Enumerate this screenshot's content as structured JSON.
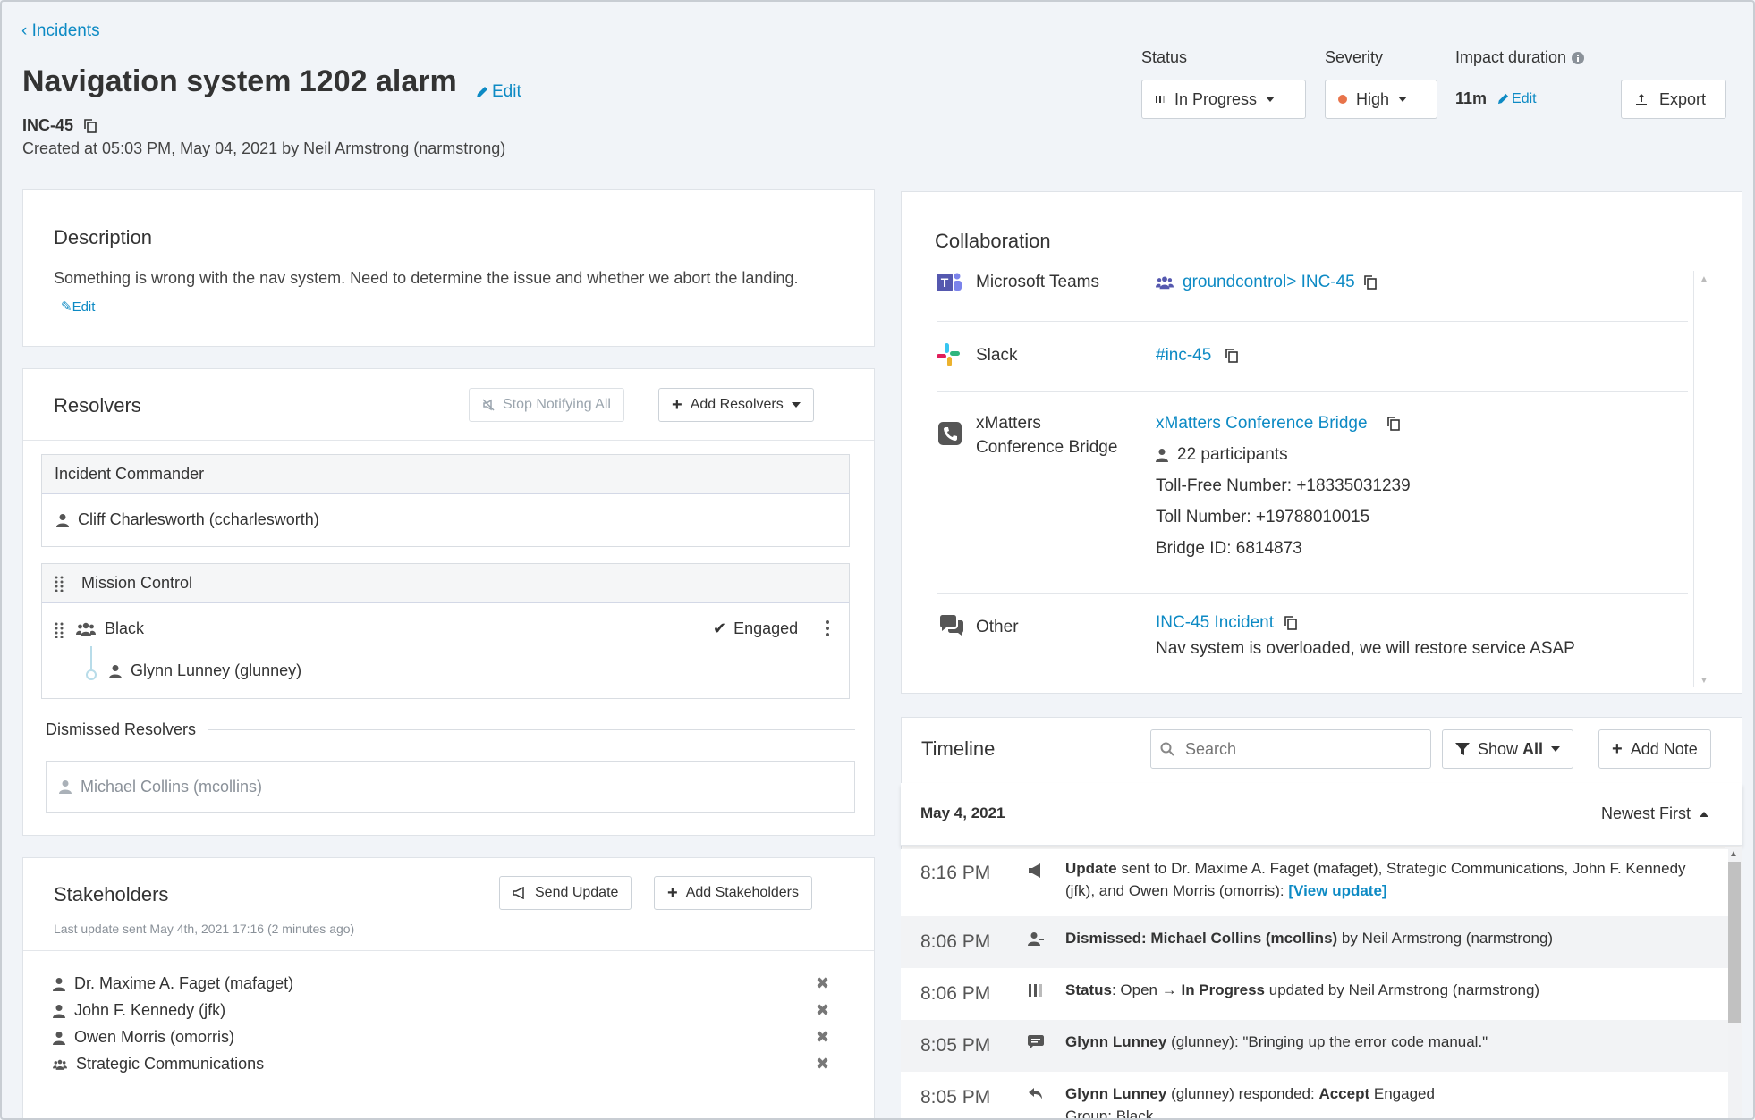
{
  "back": {
    "label": "Incidents"
  },
  "incident": {
    "title": "Navigation system 1202 alarm",
    "edit_label": "Edit",
    "id": "INC-45",
    "created": "Created at 05:03 PM, May 04, 2021 by Neil Armstrong (narmstrong)"
  },
  "header": {
    "status_label": "Status",
    "status_value": "In Progress",
    "severity_label": "Severity",
    "severity_value": "High",
    "severity_color": "#e8734a",
    "impact_label": "Impact duration",
    "impact_value": "11m",
    "impact_edit": "Edit",
    "export_label": "Export"
  },
  "description": {
    "title": "Description",
    "text": "Something is wrong with the nav system. Need to determine the issue and whether we abort the landing.",
    "edit_label": "Edit"
  },
  "resolvers": {
    "title": "Resolvers",
    "stop_label": "Stop Notifying All",
    "add_label": "Add Resolvers",
    "commander_title": "Incident Commander",
    "commander_name": "Cliff Charlesworth (ccharlesworth)",
    "mission_title": "Mission Control",
    "team_name": "Black",
    "team_status": "Engaged",
    "member_name": "Glynn Lunney (glunney)",
    "dismissed_title": "Dismissed Resolvers",
    "dismissed_name": "Michael Collins (mcollins)"
  },
  "stakeholders": {
    "title": "Stakeholders",
    "send_label": "Send Update",
    "add_label": "Add Stakeholders",
    "last_update": "Last update sent May 4th, 2021 17:16 (2 minutes ago)",
    "items": [
      {
        "name": "Dr. Maxime A. Faget (mafaget)",
        "icon": "user-icon"
      },
      {
        "name": "John F. Kennedy (jfk)",
        "icon": "user-icon"
      },
      {
        "name": "Owen Morris (omorris)",
        "icon": "user-icon"
      },
      {
        "name": "Strategic Communications",
        "icon": "group-icon"
      }
    ]
  },
  "collaboration": {
    "title": "Collaboration",
    "teams": {
      "name": "Microsoft Teams",
      "link": "groundcontrol> INC-45",
      "brand_color": "#5558af"
    },
    "slack": {
      "name": "Slack",
      "link": "#inc-45"
    },
    "bridge": {
      "name_line1": "xMatters",
      "name_line2": "Conference Bridge",
      "link": "xMatters Conference Bridge",
      "participants": "22 participants",
      "toll_free": "Toll-Free Number: +18335031239",
      "toll": "Toll Number: +19788010015",
      "bridge_id": "Bridge ID: 6814873"
    },
    "other": {
      "name": "Other",
      "link": "INC-45 Incident",
      "note": "Nav system is overloaded, we will restore service ASAP"
    }
  },
  "timeline": {
    "title": "Timeline",
    "search_placeholder": "Search",
    "filter_prefix": "Show ",
    "filter_value": "All",
    "add_note": "Add Note",
    "date": "May 4, 2021",
    "sort": "Newest First",
    "entries": [
      {
        "time": "8:16 PM",
        "bold": "Update",
        "text": " sent to Dr. Maxime A. Faget (mafaget), Strategic Communications, John F. Kennedy (jfk), and Owen Morris (omorris): ",
        "link": "[View update]"
      },
      {
        "time": "8:06 PM",
        "bold": "Dismissed: Michael Collins (mcollins)",
        "text": " by Neil Armstrong (narmstrong)"
      },
      {
        "time": "8:06 PM",
        "bold": "Status",
        "text": ": Open ",
        "arrow": "→",
        "bold2": "In Progress",
        "text2": " updated by Neil Armstrong (narmstrong)"
      },
      {
        "time": "8:05 PM",
        "bold": "Glynn Lunney",
        "text": " (glunney): \"Bringing up the error code manual.\""
      },
      {
        "time": "8:05 PM",
        "bold": "Glynn Lunney",
        "text": " (glunney) responded:  ",
        "bold2": "Accept",
        "text2": " Engaged",
        "sub": "Group: Black"
      }
    ]
  }
}
